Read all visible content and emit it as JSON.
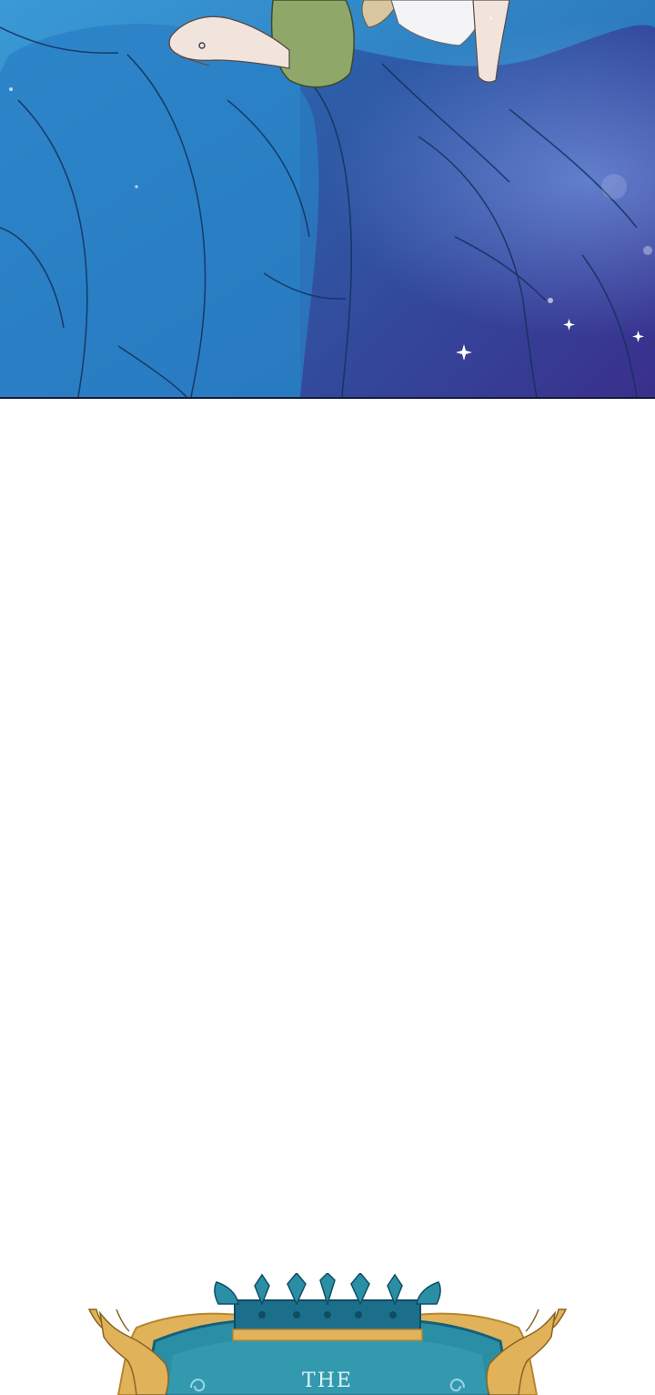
{
  "panels": {
    "top_panel": {
      "palette": {
        "blanket_light": "#2d8ac8",
        "blanket_mid": "#2367b0",
        "blanket_dark": "#3b3592",
        "sleeve_green": "#8fa86a",
        "skin": "#f1e4dc",
        "sparkle": "#ffffff"
      }
    }
  },
  "crest": {
    "title_text": "THE",
    "colors": {
      "teal": "#2a8fa5",
      "teal_dark": "#14607a",
      "gold": "#e0b35a",
      "gold_dark": "#b5862e"
    },
    "icons": [
      "crown-icon",
      "stag-left-icon",
      "stag-right-icon"
    ]
  }
}
